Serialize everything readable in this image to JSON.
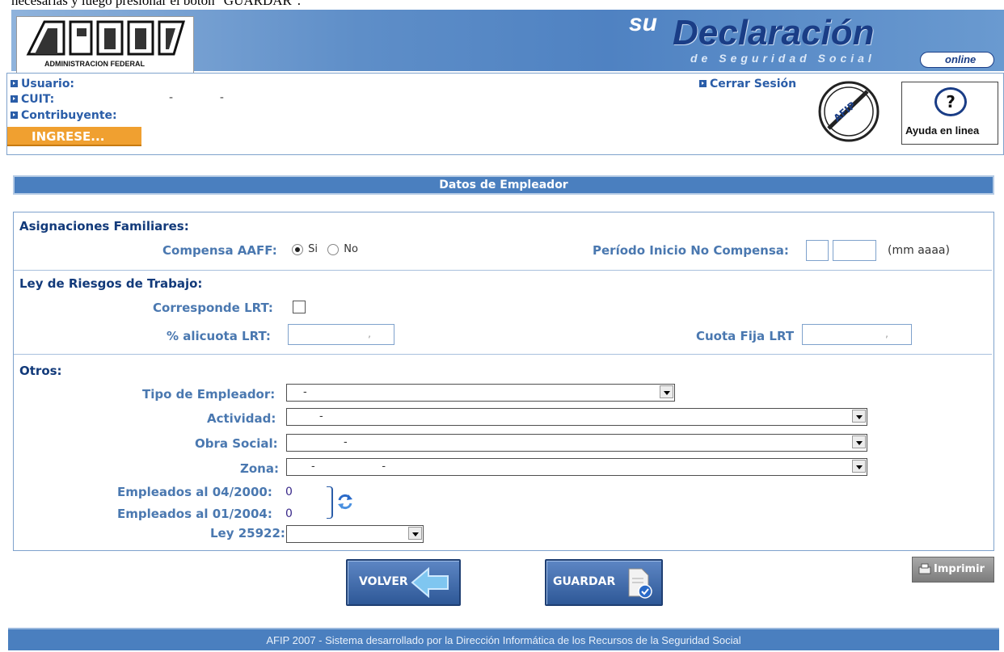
{
  "page_top_text": "necesarias y luego presionar el botón \"GUARDAR\".",
  "header": {
    "logo_text": "ADMINISTRACION FEDERAL",
    "brand_su": "su",
    "brand_title": "Declaración",
    "brand_subtitle": "de Seguridad Social",
    "brand_online": "online"
  },
  "user_panel": {
    "usuario_label": "Usuario:",
    "cuit_label": "CUIT:",
    "cuit_value": "-             -",
    "contribuyente_label": "Contribuyente:",
    "ingrese_button": "INGRESE...",
    "cerrar_sesion": "Cerrar Sesión",
    "seal_text": "AFIP",
    "ayuda_label": "Ayuda en linea"
  },
  "section_title": "Datos de Empleador",
  "asignaciones": {
    "heading": "Asignaciones Familiares:",
    "compensa_label": "Compensa AAFF:",
    "option_si": "Si",
    "option_no": "No",
    "selected": "Si",
    "periodo_label": "Período Inicio No Compensa:",
    "periodo_hint": "(mm aaaa)"
  },
  "lrt": {
    "heading": "Ley de Riesgos de Trabajo:",
    "corresponde_label": "Corresponde LRT:",
    "alicuota_label": "% alicuota LRT:",
    "alicuota_value": ",",
    "cuota_label": "Cuota Fija LRT",
    "cuota_value": ","
  },
  "otros": {
    "heading": "Otros:",
    "tipo_label": "Tipo de Empleador:",
    "tipo_value": "-",
    "actividad_label": "Actividad:",
    "actividad_value": "-",
    "obra_label": "Obra Social:",
    "obra_value": "-",
    "zona_label": "Zona:",
    "zona_value": "-                    -",
    "emp2000_label": "Empleados al 04/2000:",
    "emp2000_value": "0",
    "emp2004_label": "Empleados al 01/2004:",
    "emp2004_value": "0",
    "ley_label": "Ley 25922:"
  },
  "buttons": {
    "volver": "VOLVER",
    "guardar": "GUARDAR",
    "imprimir": "Imprimir"
  },
  "footer": "AFIP 2007 - Sistema desarrollado por la Dirección Informática de los Recursos de la Seguridad Social"
}
